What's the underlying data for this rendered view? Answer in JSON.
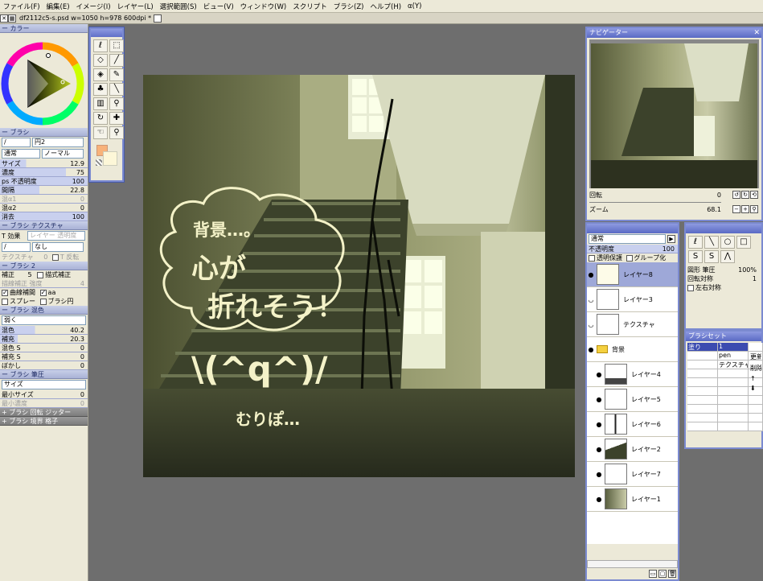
{
  "menu": [
    "ファイル(F)",
    "編集(E)",
    "イメージ(I)",
    "レイヤー(L)",
    "選択範囲(S)",
    "ビュー(V)",
    "ウィンドウ(W)",
    "スクリプト",
    "ブラシ(Z)",
    "ヘルプ(H)",
    "α(Y)"
  ],
  "tab": {
    "title": "df2112c5-s.psd w=1050 h=978 600dpi *"
  },
  "left": {
    "color_section": "ー カラー",
    "brush_section": "ー ブラシ",
    "brush_type": "/",
    "brush_name": "円2",
    "blend_mode": "通常",
    "blend_mode2": "ノーマル",
    "size": {
      "label": "サイズ",
      "value": "12.9",
      "fill": 0.3
    },
    "density": {
      "label": "濃度",
      "value": "75",
      "fill": 0.75
    },
    "ps_opacity": {
      "label": "ps 不透明度",
      "value": "100",
      "fill": 1.0
    },
    "interval": {
      "label": "間隔",
      "value": "22.8",
      "fill": 0.45
    },
    "mix1": {
      "label": "混α1",
      "value": "0"
    },
    "mix2": {
      "label": "混α2",
      "value": "0"
    },
    "erase": {
      "label": "消去",
      "value": "100",
      "fill": 1.0
    },
    "texture_section": "ー ブラシ テクスチャ",
    "t_effect_label": "T 効果",
    "t_effect_placeholder": "レイヤー 透明度",
    "t_field1": "/",
    "t_field2": "なし",
    "texture_label": "テクスチャ",
    "texture_value": "0",
    "t_invert": "T 反転",
    "brush2_section": "ー ブラシ 2",
    "correction_label": "補正",
    "correction_value": "5",
    "line_correction": "描式補正",
    "line_correction_strength": "描線補正 強度",
    "line_correction_strength_value": "4",
    "curve_interp": "曲線補間",
    "aa": "aa",
    "spray": "スプレー",
    "brush_circle": "ブラシ円",
    "brushmix_section": "ー ブラシ 混色",
    "mix_mode": "弱く",
    "mix": {
      "label": "混色",
      "value": "40.2",
      "fill": 0.4
    },
    "supplement": {
      "label": "補充",
      "value": "20.3",
      "fill": 0.2
    },
    "mix_s": {
      "label": "混色 S",
      "value": "0"
    },
    "supp_s": {
      "label": "補充 S",
      "value": "0"
    },
    "blur": {
      "label": "ぼかし",
      "value": "0"
    },
    "pressure_section": "ー ブラシ 筆圧",
    "pressure_field": "サイズ",
    "min_size": {
      "label": "最小サイズ",
      "value": "0"
    },
    "min_density": {
      "label": "最小濃度",
      "value": "0"
    },
    "rotation_jitter": "+ ブラシ 回転 ジッター",
    "boundary_grid": "+ ブラシ 境界 格子"
  },
  "navigator": {
    "title": "ナビゲーター",
    "rotation_label": "回転",
    "rotation_value": "0",
    "zoom_label": "ズーム",
    "zoom_value": "68.1"
  },
  "layers": {
    "blend": "通常",
    "opacity_label": "不透明度",
    "opacity_value": "100",
    "lock_alpha": "透明保護",
    "group_clip": "グループ化",
    "items": [
      {
        "name": "レイヤー8",
        "selected": true
      },
      {
        "name": "レイヤー3"
      },
      {
        "name": "テクスチャ"
      },
      {
        "name": "背景",
        "folder": true
      },
      {
        "name": "レイヤー4"
      },
      {
        "name": "レイヤー5"
      },
      {
        "name": "レイヤー6"
      },
      {
        "name": "レイヤー2"
      },
      {
        "name": "レイヤー7"
      },
      {
        "name": "レイヤー1"
      }
    ]
  },
  "property": {
    "shape_pressure": "図形 筆圧",
    "shape_pressure_value": "100%",
    "rot_sym": "回転対称",
    "rot_sym_value": "1",
    "lr_sym": "左右対称"
  },
  "brushset": {
    "title": "ブラシセット",
    "col1": [
      "塗り"
    ],
    "col2": [
      "1",
      "pen",
      "テクスチャ"
    ],
    "btn1": "更新",
    "btn2": "削除"
  },
  "artwork": {
    "line1": "背景…。",
    "line2": "心が",
    "line3": "折れそう！",
    "face": "\\(^q^)/",
    "line4": "むりぽ…"
  }
}
